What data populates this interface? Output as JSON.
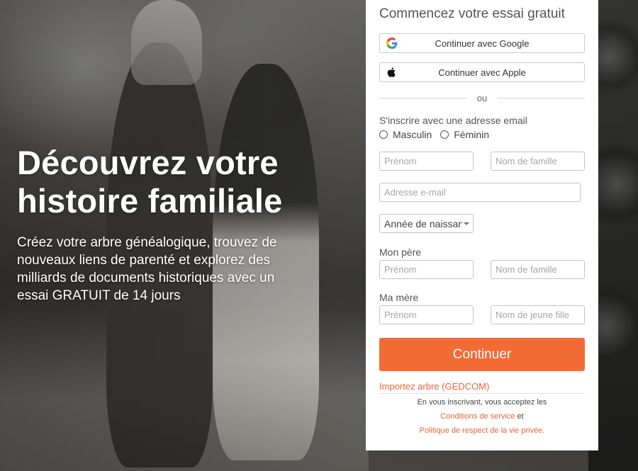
{
  "hero": {
    "title": "Découvrez votre histoire familiale",
    "subtitle": "Créez votre arbre généalogique, trouvez de nouveaux liens de parenté et explorez des milliards de documents historiques avec un essai GRATUIT de 14 jours"
  },
  "signup": {
    "title": "Commencez votre essai gratuit",
    "google_label": "Continuer avec Google",
    "apple_label": "Continuer avec Apple",
    "or_label": "ou",
    "email_heading": "S'inscrire avec une adresse email",
    "gender_options": [
      "Masculin",
      "Féminin"
    ],
    "first_name_placeholder": "Prénom",
    "last_name_placeholder": "Nom de famille",
    "email_placeholder": "Adresse e-mail",
    "birth_year_label": "Année de naissance",
    "father_label": "Mon père",
    "father_first_placeholder": "Prénom",
    "father_last_placeholder": "Nom de famille",
    "mother_label": "Ma mère",
    "mother_first_placeholder": "Prénom",
    "mother_last_placeholder": "Nom de jeune fille",
    "continue_label": "Continuer",
    "import_label": "Importez arbre (GEDCOM)",
    "legal_text": "En vous inscrivant, vous acceptez les",
    "terms_label": "Conditions de service",
    "and_label": "et",
    "privacy_label": "Politique de respect de la vie privée."
  },
  "colors": {
    "accent": "#f26b35",
    "link": "#e8643a"
  }
}
